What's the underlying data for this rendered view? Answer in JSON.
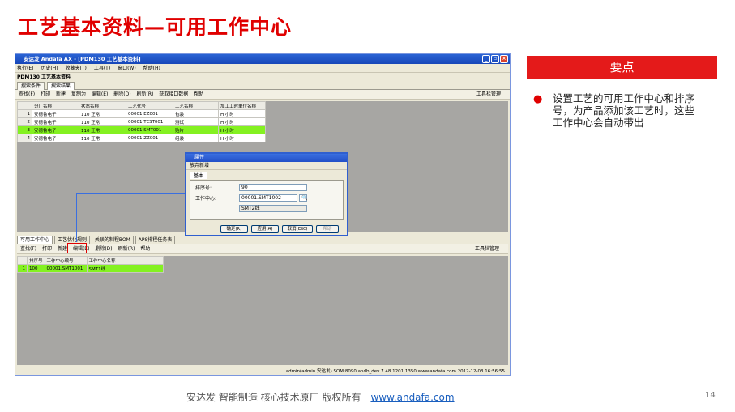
{
  "slide": {
    "title": "工艺基本资料—可用工作中心",
    "note_header": "要点",
    "bullet": "设置工艺的可用工作中心和排序号，为产品添加该工艺时，这些工作中心会自动带出",
    "footer_text": "安达发   智能制造 核心技术原厂    版权所有",
    "footer_link": "www.andafa.com",
    "page_number": "14"
  },
  "window": {
    "title": "安达发 Andafa AX - [PDM130 工艺基本资料]",
    "menus": [
      "执行(E)",
      "历史(H)",
      "收藏夹(T)",
      "工具(T)",
      "窗口(W)",
      "帮助(H)"
    ],
    "doc_label": "PDM130 工艺基本资料",
    "tabs": [
      "搜索条件",
      "搜索结果"
    ],
    "toolbar": [
      "查找(F)",
      "打印",
      "新建",
      "复制为",
      "编辑(E)",
      "删除(D)",
      "刷新(R)",
      "获取接口数据",
      "帮助"
    ],
    "toolbar_right": "工具栏管理",
    "grid_headers": [
      "分厂名称",
      "状态名称",
      "工艺代号",
      "工艺名称",
      "加工工时单位名称"
    ],
    "grid_rows": [
      {
        "n": "1",
        "c": [
          "安德鲁电子",
          "110 正常",
          "00001.EZ001",
          "包装",
          "H 小时"
        ]
      },
      {
        "n": "2",
        "c": [
          "安德鲁电子",
          "110 正常",
          "00001.TEST001",
          "测试",
          "H 小时"
        ]
      },
      {
        "n": "3",
        "c": [
          "安德鲁电子",
          "110 正常",
          "00001.SMT001",
          "贴片",
          "H 小时"
        ]
      },
      {
        "n": "4",
        "c": [
          "安德鲁电子",
          "110 正常",
          "00001.ZZ001",
          "组装",
          "H 小时"
        ]
      }
    ],
    "bottom_tabs": [
      "可用工作中心",
      "工艺优化规则",
      "关联的制程BOM",
      "APS排程任务表"
    ],
    "bottom_toolbar": [
      "查找(F)",
      "打印",
      "新建",
      "编辑(E)",
      "删除(D)",
      "刷新(R)",
      "帮助"
    ],
    "bottom_headers": [
      "排序号",
      "工作中心编号",
      "工作中心名称"
    ],
    "bottom_row": {
      "n": "1",
      "c": [
        "100",
        "00001.SMT1001",
        "SMT1线"
      ]
    },
    "status_text": "admin(admin 安达发)  SOM:8090  andb_dev  7.48.1201.1350  www.andafa.com  2012-12-03 16:56:55"
  },
  "dialog": {
    "title": "属性",
    "toolbar": "放弃新增",
    "tab": "基本",
    "field_order_label": "排序号:",
    "field_order_value": "90",
    "field_wc_label": "工作中心:",
    "field_wc_value": "00001.SMT1002",
    "field_wc_name": "SMT2线",
    "buttons": [
      "确定(K)",
      "应用(A)",
      "取消(Esc)",
      "帮助"
    ]
  }
}
